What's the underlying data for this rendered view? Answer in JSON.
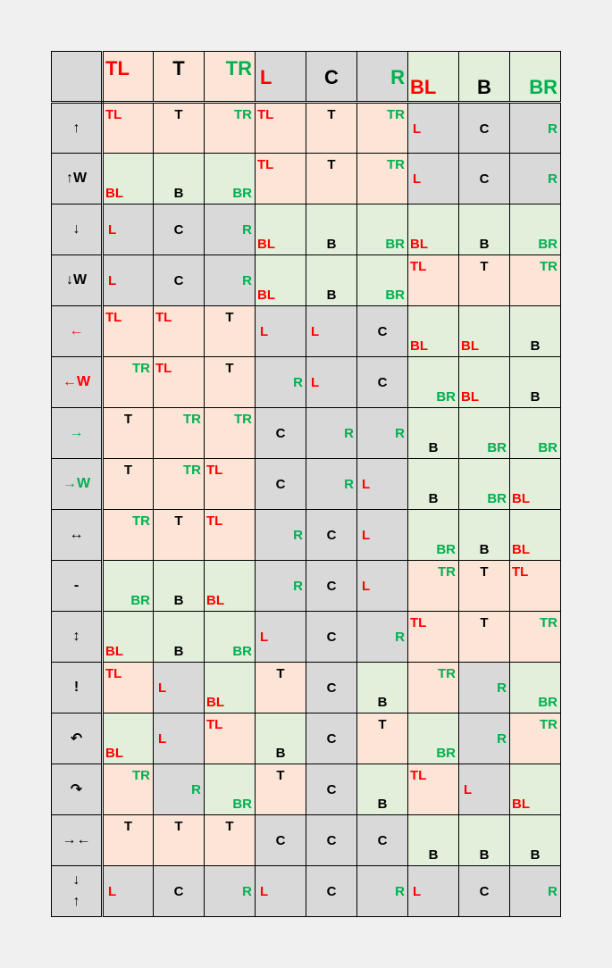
{
  "colors": {
    "pink": "#fce4d6",
    "green": "#e2efda",
    "gray": "#d9d9d9",
    "red": "#ff0000",
    "black": "#000000",
    "green_text": "#00b050"
  },
  "header": [
    {
      "text": "TL",
      "pos": "tl",
      "color": "red",
      "bg": "pink"
    },
    {
      "text": "T",
      "pos": "t",
      "color": "black",
      "bg": "pink"
    },
    {
      "text": "TR",
      "pos": "tr",
      "color": "green_text",
      "bg": "pink"
    },
    {
      "text": "L",
      "pos": "l",
      "color": "red",
      "bg": "gray"
    },
    {
      "text": "C",
      "pos": "c",
      "color": "black",
      "bg": "gray"
    },
    {
      "text": "R",
      "pos": "r",
      "color": "green_text",
      "bg": "gray"
    },
    {
      "text": "BL",
      "pos": "bl",
      "color": "red",
      "bg": "green"
    },
    {
      "text": "B",
      "pos": "b",
      "color": "black",
      "bg": "green"
    },
    {
      "text": "BR",
      "pos": "br",
      "color": "green_text",
      "bg": "green"
    }
  ],
  "rows": [
    {
      "label": "↑",
      "label_color": "black",
      "cells": [
        [
          "pink",
          "tl",
          "TL"
        ],
        [
          "pink",
          "t",
          "T"
        ],
        [
          "pink",
          "tr",
          "TR"
        ],
        [
          "pink",
          "tl",
          "TL"
        ],
        [
          "pink",
          "t",
          "T"
        ],
        [
          "pink",
          "tr",
          "TR"
        ],
        [
          "gray",
          "l",
          "L"
        ],
        [
          "gray",
          "c",
          "C"
        ],
        [
          "gray",
          "r",
          "R"
        ]
      ]
    },
    {
      "label": "↑W",
      "label_color": "black",
      "cells": [
        [
          "green",
          "bl",
          "BL"
        ],
        [
          "green",
          "b",
          "B"
        ],
        [
          "green",
          "br",
          "BR"
        ],
        [
          "pink",
          "tl",
          "TL"
        ],
        [
          "pink",
          "t",
          "T"
        ],
        [
          "pink",
          "tr",
          "TR"
        ],
        [
          "gray",
          "l",
          "L"
        ],
        [
          "gray",
          "c",
          "C"
        ],
        [
          "gray",
          "r",
          "R"
        ]
      ]
    },
    {
      "label": "↓",
      "label_color": "black",
      "cells": [
        [
          "gray",
          "l",
          "L"
        ],
        [
          "gray",
          "c",
          "C"
        ],
        [
          "gray",
          "r",
          "R"
        ],
        [
          "green",
          "bl",
          "BL"
        ],
        [
          "green",
          "b",
          "B"
        ],
        [
          "green",
          "br",
          "BR"
        ],
        [
          "green",
          "bl",
          "BL"
        ],
        [
          "green",
          "b",
          "B"
        ],
        [
          "green",
          "br",
          "BR"
        ]
      ]
    },
    {
      "label": "↓W",
      "label_color": "black",
      "cells": [
        [
          "gray",
          "l",
          "L"
        ],
        [
          "gray",
          "c",
          "C"
        ],
        [
          "gray",
          "r",
          "R"
        ],
        [
          "green",
          "bl",
          "BL"
        ],
        [
          "green",
          "b",
          "B"
        ],
        [
          "green",
          "br",
          "BR"
        ],
        [
          "pink",
          "tl",
          "TL"
        ],
        [
          "pink",
          "t",
          "T"
        ],
        [
          "pink",
          "tr",
          "TR"
        ]
      ]
    },
    {
      "label": "←",
      "label_color": "red",
      "cells": [
        [
          "pink",
          "tl",
          "TL"
        ],
        [
          "pink",
          "tl",
          "TL"
        ],
        [
          "pink",
          "t",
          "T"
        ],
        [
          "gray",
          "l",
          "L"
        ],
        [
          "gray",
          "l",
          "L"
        ],
        [
          "gray",
          "c",
          "C"
        ],
        [
          "green",
          "bl",
          "BL"
        ],
        [
          "green",
          "bl",
          "BL"
        ],
        [
          "green",
          "b",
          "B"
        ]
      ]
    },
    {
      "label": "←W",
      "label_color": "red",
      "cells": [
        [
          "pink",
          "tr",
          "TR"
        ],
        [
          "pink",
          "tl",
          "TL"
        ],
        [
          "pink",
          "t",
          "T"
        ],
        [
          "gray",
          "r",
          "R"
        ],
        [
          "gray",
          "l",
          "L"
        ],
        [
          "gray",
          "c",
          "C"
        ],
        [
          "green",
          "br",
          "BR"
        ],
        [
          "green",
          "bl",
          "BL"
        ],
        [
          "green",
          "b",
          "B"
        ]
      ]
    },
    {
      "label": "→",
      "label_color": "green_text",
      "cells": [
        [
          "pink",
          "t",
          "T"
        ],
        [
          "pink",
          "tr",
          "TR"
        ],
        [
          "pink",
          "tr",
          "TR"
        ],
        [
          "gray",
          "c",
          "C"
        ],
        [
          "gray",
          "r",
          "R"
        ],
        [
          "gray",
          "r",
          "R"
        ],
        [
          "green",
          "b",
          "B"
        ],
        [
          "green",
          "br",
          "BR"
        ],
        [
          "green",
          "br",
          "BR"
        ]
      ]
    },
    {
      "label": "→W",
      "label_color": "green_text",
      "cells": [
        [
          "pink",
          "t",
          "T"
        ],
        [
          "pink",
          "tr",
          "TR"
        ],
        [
          "pink",
          "tl",
          "TL"
        ],
        [
          "gray",
          "c",
          "C"
        ],
        [
          "gray",
          "r",
          "R"
        ],
        [
          "gray",
          "l",
          "L"
        ],
        [
          "green",
          "b",
          "B"
        ],
        [
          "green",
          "br",
          "BR"
        ],
        [
          "green",
          "bl",
          "BL"
        ]
      ]
    },
    {
      "label": "↔",
      "label_color": "black",
      "cells": [
        [
          "pink",
          "tr",
          "TR"
        ],
        [
          "pink",
          "t",
          "T"
        ],
        [
          "pink",
          "tl",
          "TL"
        ],
        [
          "gray",
          "r",
          "R"
        ],
        [
          "gray",
          "c",
          "C"
        ],
        [
          "gray",
          "l",
          "L"
        ],
        [
          "green",
          "br",
          "BR"
        ],
        [
          "green",
          "b",
          "B"
        ],
        [
          "green",
          "bl",
          "BL"
        ]
      ]
    },
    {
      "label": "-",
      "label_color": "black",
      "cells": [
        [
          "green",
          "br",
          "BR"
        ],
        [
          "green",
          "b",
          "B"
        ],
        [
          "green",
          "bl",
          "BL"
        ],
        [
          "gray",
          "r",
          "R"
        ],
        [
          "gray",
          "c",
          "C"
        ],
        [
          "gray",
          "l",
          "L"
        ],
        [
          "pink",
          "tr",
          "TR"
        ],
        [
          "pink",
          "t",
          "T"
        ],
        [
          "pink",
          "tl",
          "TL"
        ]
      ]
    },
    {
      "label": "↕",
      "label_color": "black",
      "cells": [
        [
          "green",
          "bl",
          "BL"
        ],
        [
          "green",
          "b",
          "B"
        ],
        [
          "green",
          "br",
          "BR"
        ],
        [
          "gray",
          "l",
          "L"
        ],
        [
          "gray",
          "c",
          "C"
        ],
        [
          "gray",
          "r",
          "R"
        ],
        [
          "pink",
          "tl",
          "TL"
        ],
        [
          "pink",
          "t",
          "T"
        ],
        [
          "pink",
          "tr",
          "TR"
        ]
      ]
    },
    {
      "label": "!",
      "label_color": "black",
      "cells": [
        [
          "pink",
          "tl",
          "TL"
        ],
        [
          "gray",
          "l",
          "L"
        ],
        [
          "green",
          "bl",
          "BL"
        ],
        [
          "pink",
          "t",
          "T"
        ],
        [
          "gray",
          "c",
          "C"
        ],
        [
          "green",
          "b",
          "B"
        ],
        [
          "pink",
          "tr",
          "TR"
        ],
        [
          "gray",
          "r",
          "R"
        ],
        [
          "green",
          "br",
          "BR"
        ]
      ]
    },
    {
      "label": "↶",
      "label_color": "black",
      "icon": "rotate-ccw-icon",
      "cells": [
        [
          "green",
          "bl",
          "BL"
        ],
        [
          "gray",
          "l",
          "L"
        ],
        [
          "pink",
          "tl",
          "TL"
        ],
        [
          "green",
          "b",
          "B"
        ],
        [
          "gray",
          "c",
          "C"
        ],
        [
          "pink",
          "t",
          "T"
        ],
        [
          "green",
          "br",
          "BR"
        ],
        [
          "gray",
          "r",
          "R"
        ],
        [
          "pink",
          "tr",
          "TR"
        ]
      ]
    },
    {
      "label": "↷",
      "label_color": "black",
      "icon": "rotate-cw-icon",
      "cells": [
        [
          "pink",
          "tr",
          "TR"
        ],
        [
          "gray",
          "r",
          "R"
        ],
        [
          "green",
          "br",
          "BR"
        ],
        [
          "pink",
          "t",
          "T"
        ],
        [
          "gray",
          "c",
          "C"
        ],
        [
          "green",
          "b",
          "B"
        ],
        [
          "pink",
          "tl",
          "TL"
        ],
        [
          "gray",
          "l",
          "L"
        ],
        [
          "green",
          "bl",
          "BL"
        ]
      ]
    },
    {
      "label": "→←",
      "label_color": "black",
      "cells": [
        [
          "pink",
          "t",
          "T"
        ],
        [
          "pink",
          "t",
          "T"
        ],
        [
          "pink",
          "t",
          "T"
        ],
        [
          "gray",
          "c",
          "C"
        ],
        [
          "gray",
          "c",
          "C"
        ],
        [
          "gray",
          "c",
          "C"
        ],
        [
          "green",
          "b",
          "B"
        ],
        [
          "green",
          "b",
          "B"
        ],
        [
          "green",
          "b",
          "B"
        ]
      ]
    },
    {
      "label": "↓↑",
      "label_color": "black",
      "stacked": true,
      "cells": [
        [
          "gray",
          "l",
          "L"
        ],
        [
          "gray",
          "c",
          "C"
        ],
        [
          "gray",
          "r",
          "R"
        ],
        [
          "gray",
          "l",
          "L"
        ],
        [
          "gray",
          "c",
          "C"
        ],
        [
          "gray",
          "r",
          "R"
        ],
        [
          "gray",
          "l",
          "L"
        ],
        [
          "gray",
          "c",
          "C"
        ],
        [
          "gray",
          "r",
          "R"
        ]
      ]
    }
  ]
}
